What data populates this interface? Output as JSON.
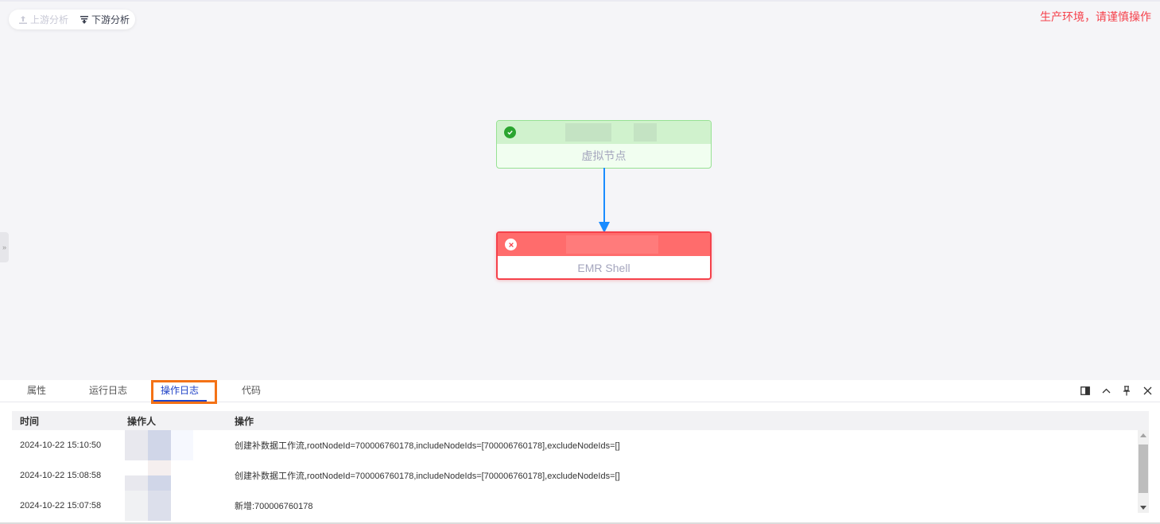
{
  "toolbar": {
    "upstream_label": "上游分析",
    "downstream_label": "下游分析",
    "env_warning": "生产环境，请谨慎操作"
  },
  "graph": {
    "nodes": [
      {
        "status": "success",
        "type_label": "虚拟节点"
      },
      {
        "status": "failed",
        "type_label": "EMR Shell"
      }
    ],
    "edge_color": "#1a8cff"
  },
  "panel": {
    "tabs": [
      {
        "label": "属性"
      },
      {
        "label": "运行日志"
      },
      {
        "label": "操作日志"
      },
      {
        "label": "代码"
      }
    ],
    "active_tab": "操作日志",
    "table": {
      "headers": {
        "time": "时间",
        "user": "操作人",
        "operation": "操作"
      },
      "rows": [
        {
          "time": "2024-10-22 15:10:50",
          "operation": "创建补数据工作流,rootNodeId=700006760178,includeNodeIds=[700006760178],excludeNodeIds=[]"
        },
        {
          "time": "2024-10-22 15:08:58",
          "operation": "创建补数据工作流,rootNodeId=700006760178,includeNodeIds=[700006760178],excludeNodeIds=[]"
        },
        {
          "time": "2024-10-22 15:07:58",
          "operation": "新增:700006760178"
        }
      ]
    }
  },
  "colors": {
    "warning": "#f5414b",
    "accent": "#2043c7",
    "highlight": "#f47216",
    "success": "#2aa52f"
  }
}
